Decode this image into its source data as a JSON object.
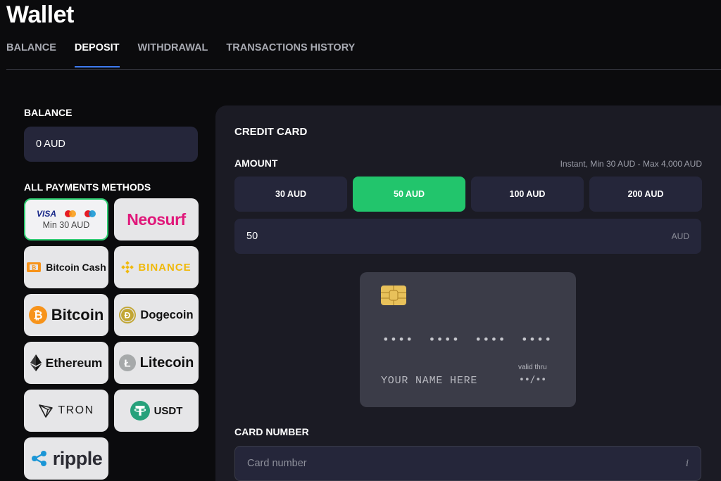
{
  "header": {
    "title": "Wallet"
  },
  "tabs": [
    {
      "label": "BALANCE"
    },
    {
      "label": "DEPOSIT"
    },
    {
      "label": "WITHDRAWAL"
    },
    {
      "label": "TRANSACTIONS HISTORY"
    }
  ],
  "active_tab": "DEPOSIT",
  "balance": {
    "label": "BALANCE",
    "value": "0 AUD"
  },
  "methods": {
    "label": "ALL PAYMENTS METHODS",
    "items": [
      {
        "name": "VISA",
        "min": "Min 30 AUD",
        "selected": true
      },
      {
        "name": "Neosurf"
      },
      {
        "name": "Bitcoin Cash"
      },
      {
        "name": "BINANCE"
      },
      {
        "name": "Bitcoin"
      },
      {
        "name": "Dogecoin"
      },
      {
        "name": "Ethereum"
      },
      {
        "name": "Litecoin"
      },
      {
        "name": "TRON"
      },
      {
        "name": "USDT"
      },
      {
        "name": "ripple"
      }
    ]
  },
  "deposit": {
    "title": "CREDIT CARD",
    "amount_label": "AMOUNT",
    "amount_hint": "Instant, Min 30 AUD - Max 4,000 AUD",
    "presets": [
      "30 AUD",
      "50 AUD",
      "100 AUD",
      "200 AUD"
    ],
    "selected_preset": "50 AUD",
    "amount_value": "50",
    "currency": "AUD",
    "card": {
      "number": "•••• •••• •••• ••••",
      "name": "YOUR NAME HERE",
      "valid_label": "valid thru",
      "valid_value": "••/••"
    },
    "card_number_label": "CARD NUMBER",
    "card_number_placeholder": "Card number",
    "info_icon": "i"
  },
  "colors": {
    "accent_green": "#22c56c",
    "tab_underline": "#3e7bf0",
    "panel_bg": "#1b1b24",
    "field_bg": "#25263a"
  }
}
